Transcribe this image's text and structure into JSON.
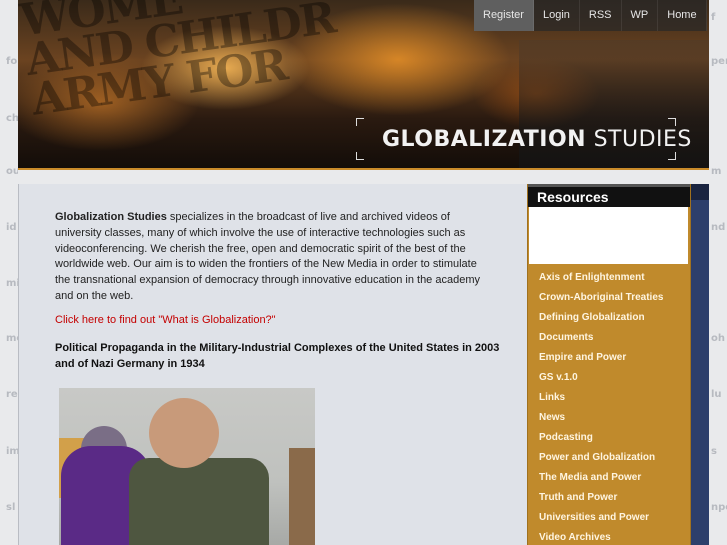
{
  "background_words": {
    "left": [
      "fo",
      "ch",
      "ou",
      "id",
      "mi",
      "mo",
      "rel",
      "im",
      "sl"
    ],
    "right": [
      "f",
      "per",
      "m",
      "nd",
      "oh",
      "lu",
      "s",
      "npe"
    ]
  },
  "banner": {
    "background_text": [
      "WOME",
      "AND CHILDR",
      "ARMY FOR"
    ],
    "brand_bold": "GLOBALIZATION",
    "brand_light": "STUDIES"
  },
  "topnav": {
    "items": [
      {
        "label": "Register",
        "active": true
      },
      {
        "label": "Login",
        "active": false
      },
      {
        "label": "RSS",
        "active": false
      },
      {
        "label": "WP",
        "active": false
      },
      {
        "label": "Home",
        "active": false
      }
    ]
  },
  "main": {
    "intro_bold": "Globalization Studies",
    "intro_text": " specializes in the broadcast of live and archived videos of university classes, many of which involve the use of interactive technologies such as videoconferencing. We cherish the free, open and democratic spirit of the best of the worldwide web. Our aim is to widen the frontiers of the New Media in order to stimulate the transnational expansion of democracy through innovative education in the academy and on the web.",
    "link_text": "Click here to find out \"What is Globalization?\"",
    "headline": "Political Propaganda in the Military-Industrial Complexes of the United States in 2003 and of Nazi Germany in 1934"
  },
  "sidebar": {
    "title": "Resources",
    "items": [
      "Axis of Enlightenment",
      "Crown-Aboriginal Treaties",
      "Defining Globalization",
      "Documents",
      "Empire and Power",
      "GS v.1.0",
      "Links",
      "News",
      "Podcasting",
      "Power and Globalization",
      "The Media and Power",
      "Truth and Power",
      "Universities and Power",
      "Video Archives"
    ]
  },
  "colors": {
    "sidebar": "#c08a2c",
    "link": "#c40000",
    "content_bg": "#dfe2e8"
  }
}
